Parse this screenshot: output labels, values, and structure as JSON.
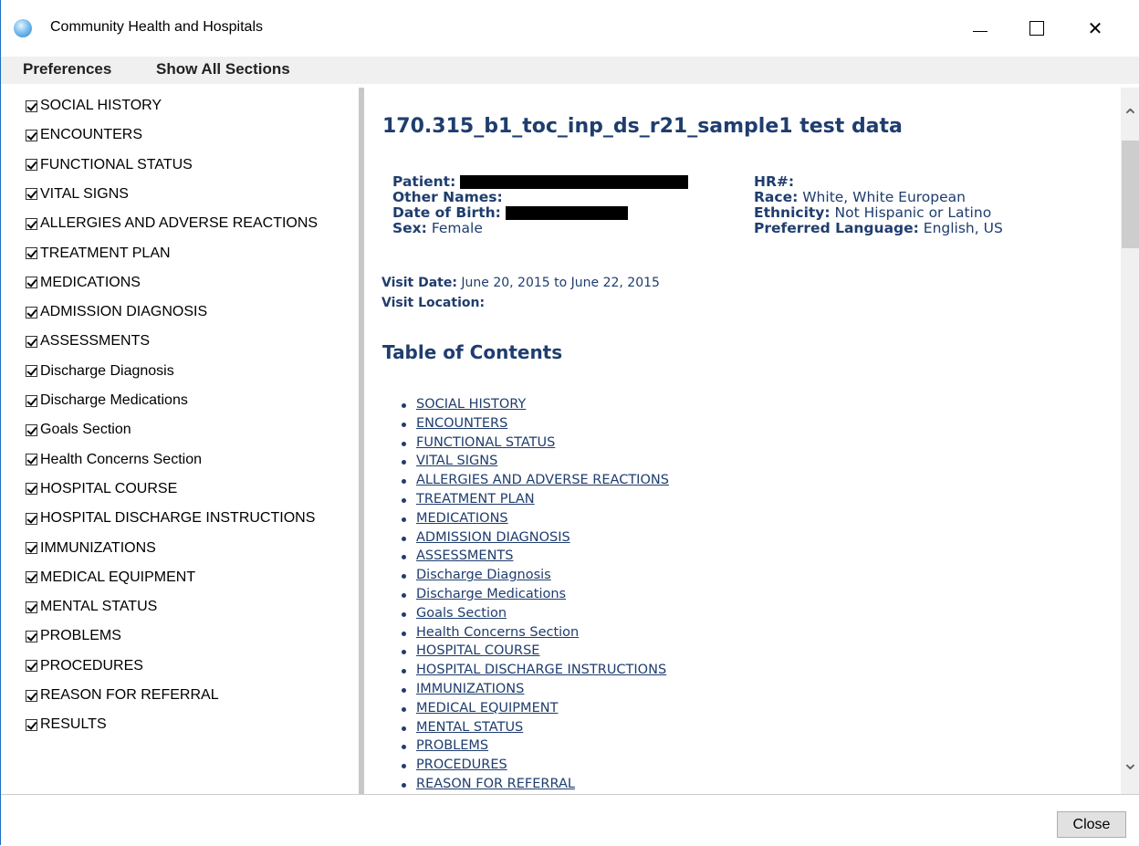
{
  "window": {
    "title": "Community Health and Hospitals",
    "controls": {
      "minimize": "minimize",
      "maximize": "maximize",
      "close": "✕"
    }
  },
  "menu": {
    "preferences": "Preferences",
    "show_all_sections": "Show All Sections"
  },
  "sections": [
    {
      "label": "SOCIAL HISTORY",
      "checked": true
    },
    {
      "label": "ENCOUNTERS",
      "checked": true
    },
    {
      "label": "FUNCTIONAL STATUS",
      "checked": true
    },
    {
      "label": "VITAL SIGNS",
      "checked": true
    },
    {
      "label": "ALLERGIES AND ADVERSE REACTIONS",
      "checked": true
    },
    {
      "label": "TREATMENT PLAN",
      "checked": true
    },
    {
      "label": "MEDICATIONS",
      "checked": true
    },
    {
      "label": "ADMISSION DIAGNOSIS",
      "checked": true
    },
    {
      "label": "ASSESSMENTS",
      "checked": true
    },
    {
      "label": "Discharge Diagnosis",
      "checked": true
    },
    {
      "label": "Discharge Medications",
      "checked": true
    },
    {
      "label": "Goals Section",
      "checked": true
    },
    {
      "label": "Health Concerns Section",
      "checked": true
    },
    {
      "label": "HOSPITAL COURSE",
      "checked": true
    },
    {
      "label": "HOSPITAL DISCHARGE INSTRUCTIONS",
      "checked": true
    },
    {
      "label": "IMMUNIZATIONS",
      "checked": true
    },
    {
      "label": "MEDICAL EQUIPMENT",
      "checked": true
    },
    {
      "label": "MENTAL STATUS",
      "checked": true
    },
    {
      "label": "PROBLEMS",
      "checked": true
    },
    {
      "label": "PROCEDURES",
      "checked": true
    },
    {
      "label": "REASON FOR REFERRAL",
      "checked": true
    },
    {
      "label": "RESULTS",
      "checked": true
    }
  ],
  "document": {
    "title": "170.315_b1_toc_inp_ds_r21_sample1 test data",
    "patient_label": "Patient:",
    "other_names_label": "Other Names:",
    "dob_label": "Date of Birth:",
    "sex_label": "Sex:",
    "sex_value": "Female",
    "hr_label": "HR#:",
    "race_label": "Race:",
    "race_value": "White, White European",
    "ethnicity_label": "Ethnicity:",
    "ethnicity_value": "Not Hispanic or Latino",
    "language_label": "Preferred Language:",
    "language_value": "English, US",
    "visit_date_label": "Visit Date:",
    "visit_date_value": "June 20, 2015 to June 22, 2015",
    "visit_location_label": "Visit Location:",
    "toc_title": "Table of Contents",
    "toc": [
      "SOCIAL HISTORY",
      "ENCOUNTERS",
      "FUNCTIONAL STATUS",
      "VITAL SIGNS",
      "ALLERGIES AND ADVERSE REACTIONS",
      "TREATMENT PLAN",
      "MEDICATIONS",
      "ADMISSION DIAGNOSIS",
      "ASSESSMENTS",
      "Discharge Diagnosis",
      "Discharge Medications",
      "Goals Section",
      "Health Concerns Section",
      "HOSPITAL COURSE",
      "HOSPITAL DISCHARGE INSTRUCTIONS",
      "IMMUNIZATIONS",
      "MEDICAL EQUIPMENT",
      "MENTAL STATUS",
      "PROBLEMS",
      "PROCEDURES",
      "REASON FOR REFERRAL"
    ]
  },
  "footer": {
    "close_label": "Close"
  },
  "colors": {
    "heading": "#1f3d6e",
    "menubar": "#f0f0f0",
    "splitter": "#c8c8c8"
  }
}
